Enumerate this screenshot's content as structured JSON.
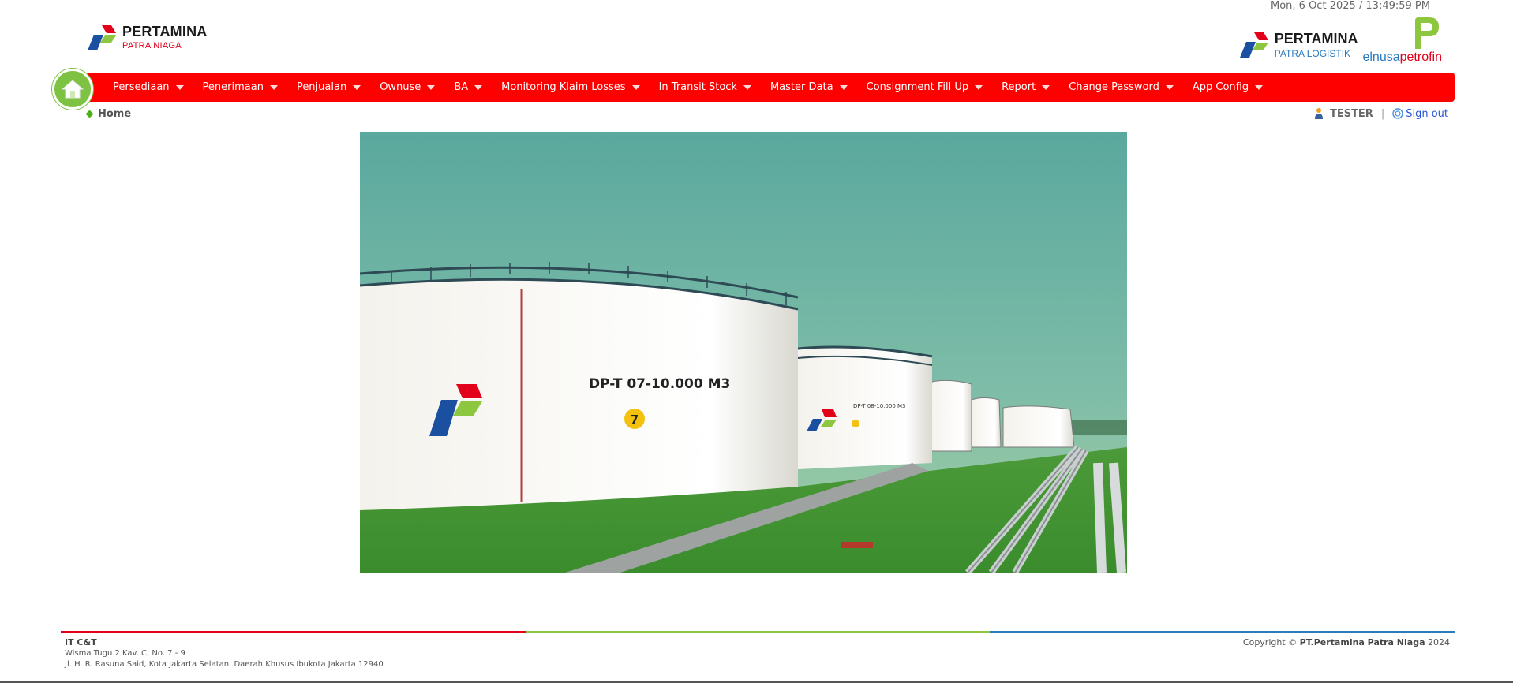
{
  "header": {
    "datetime": "Mon, 6 Oct 2025 / 13:49:59 PM",
    "logo_left": {
      "brand": "PERTAMINA",
      "sub": "PATRA NIAGA"
    },
    "logo_right": {
      "brand": "PERTAMINA",
      "sub": "PATRA LOGISTIK",
      "partner_part1": "elnusa",
      "partner_part2": "petrofin"
    }
  },
  "nav": {
    "home_icon": "house-icon",
    "items": [
      {
        "label": "Persediaan"
      },
      {
        "label": "Penerimaan"
      },
      {
        "label": "Penjualan"
      },
      {
        "label": "Ownuse"
      },
      {
        "label": "BA"
      },
      {
        "label": "Monitoring Klaim Losses"
      },
      {
        "label": "In Transit Stock"
      },
      {
        "label": "Master Data"
      },
      {
        "label": "Consignment Fill Up"
      },
      {
        "label": "Report"
      },
      {
        "label": "Change Password"
      },
      {
        "label": "App Config"
      }
    ]
  },
  "breadcrumb": {
    "label": "Home"
  },
  "user": {
    "name": "TESTER",
    "separator": "|",
    "signout": "Sign out"
  },
  "hero": {
    "tank_label": "DP-T 07-10.000 M3",
    "tank_number": "7",
    "tank_label_2": "DP-T 08-10.000 M3"
  },
  "footer": {
    "org": "IT C&T",
    "address_line1": "Wisma Tugu 2 Kav. C, No. 7 - 9",
    "address_line2": "Jl. H. R. Rasuna Said, Kota Jakarta Selatan, Daerah Khusus Ibukota Jakarta 12940",
    "copyright_prefix": "Copyright ©",
    "company": "PT.Pertamina Patra Niaga",
    "year": "2024"
  },
  "colors": {
    "nav_bg": "#ff0000",
    "home_green": "#7dc242",
    "brand_red": "#e3001b",
    "brand_blue": "#2a7bbf",
    "brand_green": "#8dc63f",
    "link_blue": "#2a54d6"
  }
}
